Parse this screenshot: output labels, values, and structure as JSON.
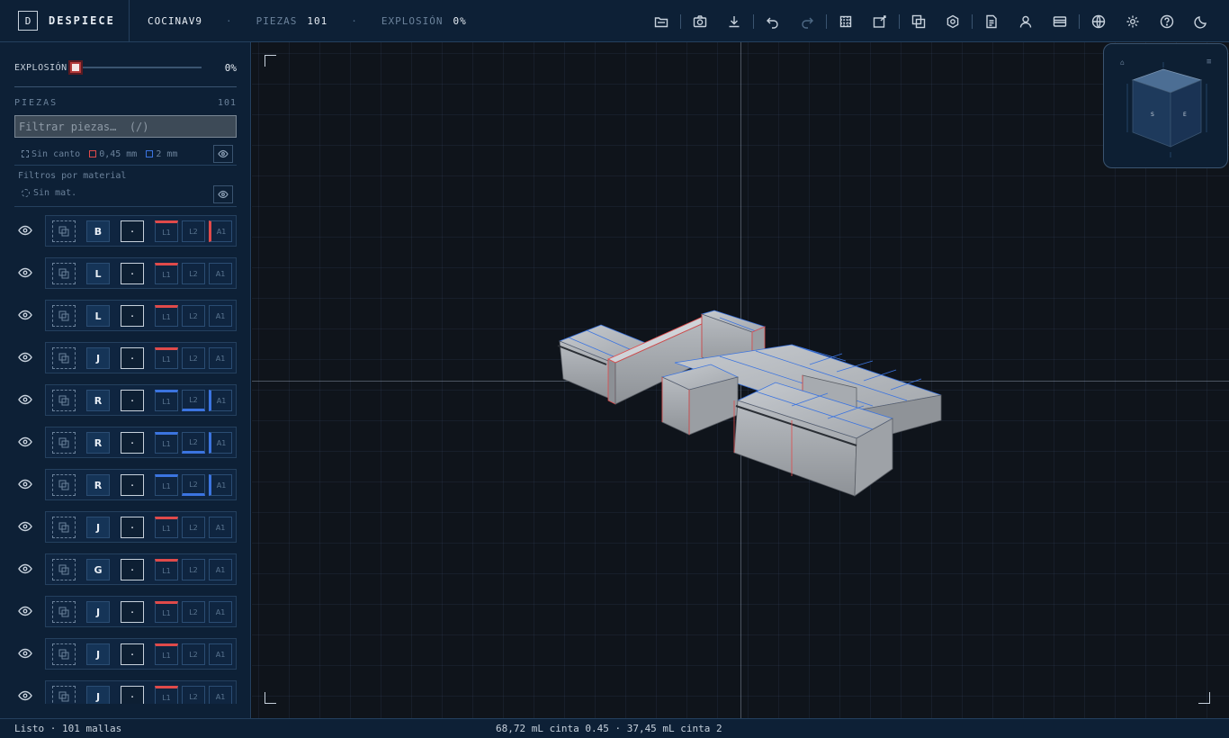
{
  "brand": {
    "logo_letter": "D",
    "name": "DESPIECE"
  },
  "header": {
    "project": "COCINAV9",
    "separator": "·",
    "pieces_label": "PIEZAS",
    "pieces_value": "101",
    "explosion_label": "EXPLOSIÓN",
    "explosion_value": "0%"
  },
  "toolbar": {
    "icons": [
      "folder-open-icon",
      "camera-icon",
      "download-icon",
      "undo-icon",
      "redo-icon",
      "grid-box-icon",
      "edit-sheet-icon",
      "layers-icon",
      "hex-nut-icon",
      "document-icon",
      "user-icon",
      "card-icon",
      "globe-icon",
      "gear-icon",
      "help-icon",
      "moon-icon"
    ]
  },
  "sidebar": {
    "explosion_label": "EXPLOSIÓN",
    "explosion_value": "0%",
    "explosion_level": 0,
    "pieces_title": "PIEZAS",
    "pieces_count": "101",
    "filter_placeholder": "Filtrar piezas…  (/)",
    "edge_legend": {
      "none": "Sin canto",
      "thin": "0,45 mm",
      "thick": "2 mm"
    },
    "material_title": "Filtros por material",
    "material_none": "Sin mat."
  },
  "pieces": [
    {
      "letter": "B",
      "mark": "·",
      "l1": "L1",
      "l2": "L2",
      "a1": "A1",
      "l1_edge": "red",
      "l2_edge": "",
      "a1_edge": "red"
    },
    {
      "letter": "L",
      "mark": "·",
      "l1": "L1",
      "l2": "L2",
      "a1": "A1",
      "l1_edge": "red",
      "l2_edge": "",
      "a1_edge": ""
    },
    {
      "letter": "L",
      "mark": "·",
      "l1": "L1",
      "l2": "L2",
      "a1": "A1",
      "l1_edge": "red",
      "l2_edge": "",
      "a1_edge": ""
    },
    {
      "letter": "J",
      "mark": "·",
      "l1": "L1",
      "l2": "L2",
      "a1": "A1",
      "l1_edge": "red",
      "l2_edge": "",
      "a1_edge": ""
    },
    {
      "letter": "R",
      "mark": "·",
      "l1": "L1",
      "l2": "L2",
      "a1": "A1",
      "l1_edge": "blue",
      "l2_edge": "blue",
      "a1_edge": "blue"
    },
    {
      "letter": "R",
      "mark": "·",
      "l1": "L1",
      "l2": "L2",
      "a1": "A1",
      "l1_edge": "blue",
      "l2_edge": "blue",
      "a1_edge": "blue"
    },
    {
      "letter": "R",
      "mark": "·",
      "l1": "L1",
      "l2": "L2",
      "a1": "A1",
      "l1_edge": "blue",
      "l2_edge": "blue",
      "a1_edge": "blue"
    },
    {
      "letter": "J",
      "mark": "·",
      "l1": "L1",
      "l2": "L2",
      "a1": "A1",
      "l1_edge": "red",
      "l2_edge": "",
      "a1_edge": ""
    },
    {
      "letter": "G",
      "mark": "·",
      "l1": "L1",
      "l2": "L2",
      "a1": "A1",
      "l1_edge": "red",
      "l2_edge": "",
      "a1_edge": ""
    },
    {
      "letter": "J",
      "mark": "·",
      "l1": "L1",
      "l2": "L2",
      "a1": "A1",
      "l1_edge": "red",
      "l2_edge": "",
      "a1_edge": ""
    },
    {
      "letter": "J",
      "mark": "·",
      "l1": "L1",
      "l2": "L2",
      "a1": "A1",
      "l1_edge": "red",
      "l2_edge": "",
      "a1_edge": ""
    },
    {
      "letter": "J",
      "mark": "·",
      "l1": "L1",
      "l2": "L2",
      "a1": "A1",
      "l1_edge": "red",
      "l2_edge": "",
      "a1_edge": ""
    }
  ],
  "viewport": {
    "navcube_home": "⌂",
    "navcube_menu": "≡"
  },
  "status": {
    "left": "Listo · 101 mallas",
    "center": "68,72 mL cinta 0.45 · 37,45 mL cinta 2"
  },
  "colors": {
    "edge_thin": "#e04a4a",
    "edge_thick": "#3b74e0",
    "panel": "#0d2036",
    "viewport": "#0f141b"
  }
}
